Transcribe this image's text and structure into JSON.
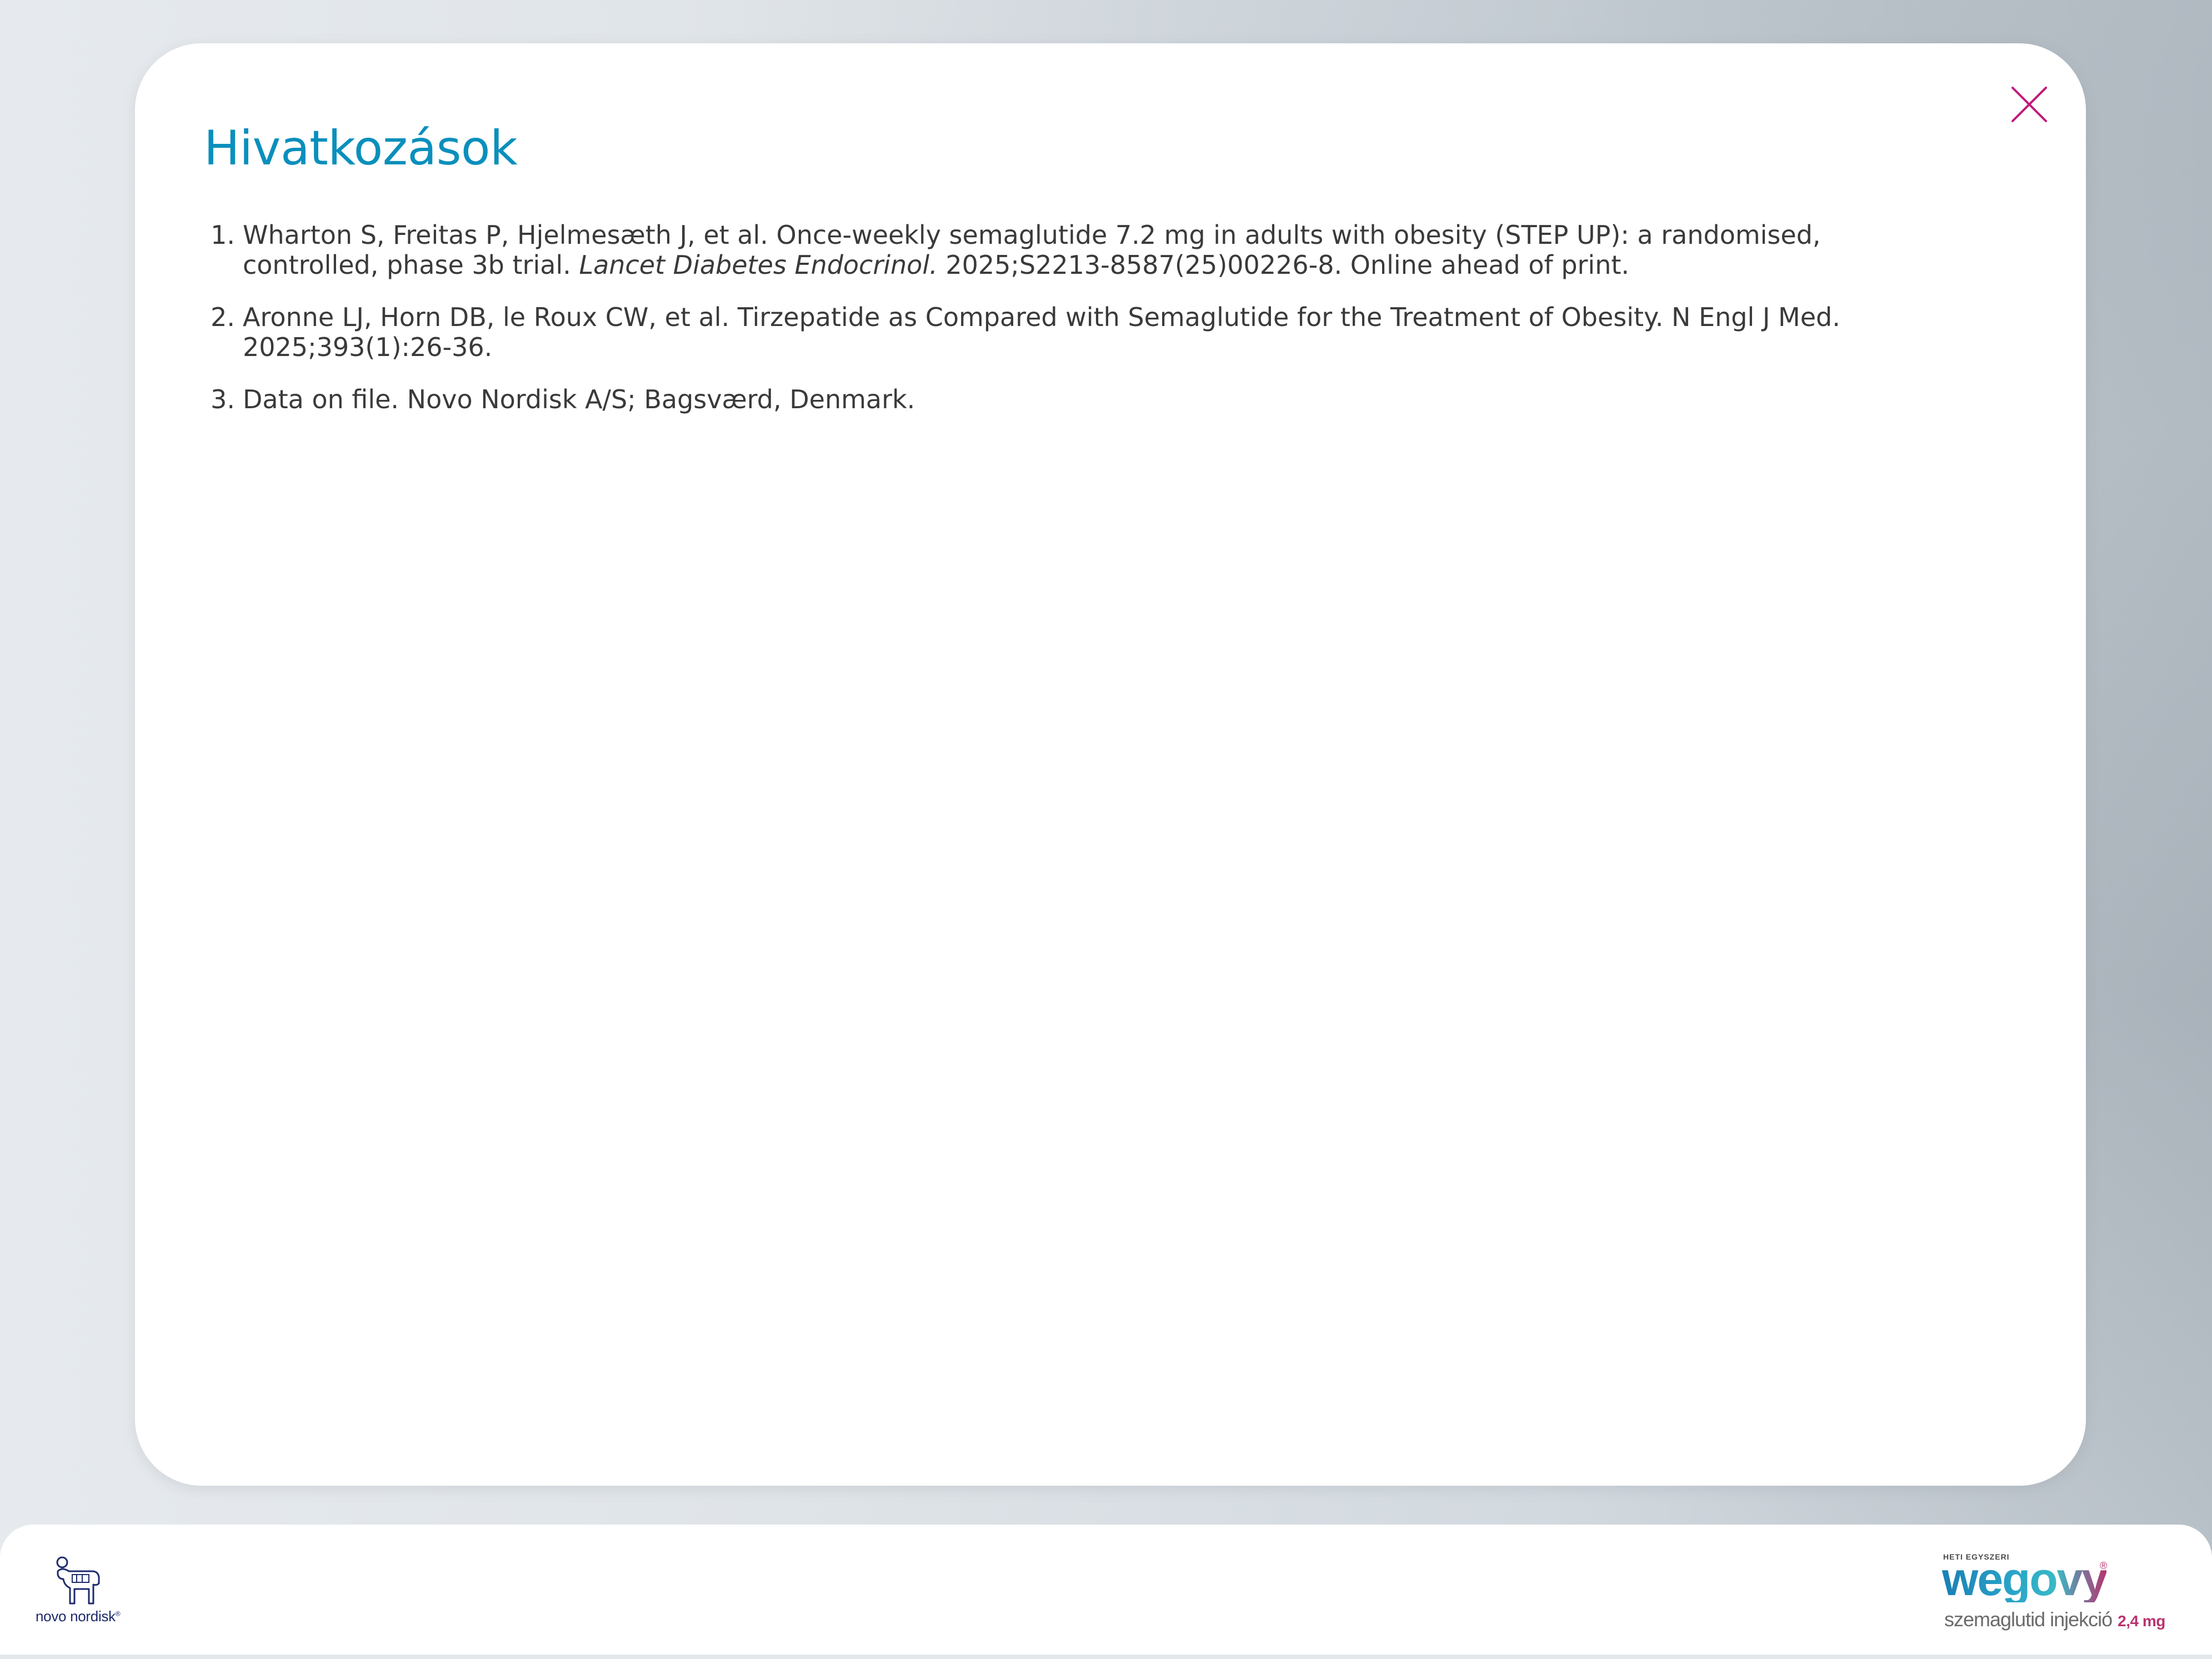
{
  "modal": {
    "title": "Hivatkozások",
    "close_icon": "close-icon",
    "references": [
      {
        "number": "1.",
        "text_before": "Wharton S, Freitas P, Hjelmesæth J, et al. Once-weekly semaglutide 7.2 mg in adults with obesity (STEP UP): a randomised, controlled, phase 3b trial. ",
        "journal": "Lancet Diabetes Endocrinol.",
        "text_after": " 2025;S2213-8587(25)00226-8. Online ahead of print."
      },
      {
        "number": "2.",
        "text_before": "Aronne LJ, Horn DB, le Roux CW, et al. Tirzepatide as Compared with Semaglutide for the Treatment of Obesity. N Engl J Med. 2025;393(1):26-36.",
        "journal": "",
        "text_after": ""
      },
      {
        "number": "3.",
        "text_before": "Data on file. Novo Nordisk A/S; Bagsværd, Denmark.",
        "journal": "",
        "text_after": ""
      }
    ]
  },
  "footer": {
    "left_logo": {
      "icon": "novo-nordisk-apis-bull-icon",
      "text": "novo nordisk",
      "reg": "®"
    },
    "right_logo": {
      "top_text": "HETI EGYSZERI",
      "brand": "wegovy",
      "reg": "®",
      "subtitle": "szemaglutid injekció",
      "dose": "2,4 mg"
    }
  },
  "colors": {
    "title": "#0a8fbc",
    "close_icon": "#c2187a",
    "body_text": "#3a3a3a",
    "brand_magenta": "#b9336f",
    "nn_blue": "#1e2a6e"
  }
}
